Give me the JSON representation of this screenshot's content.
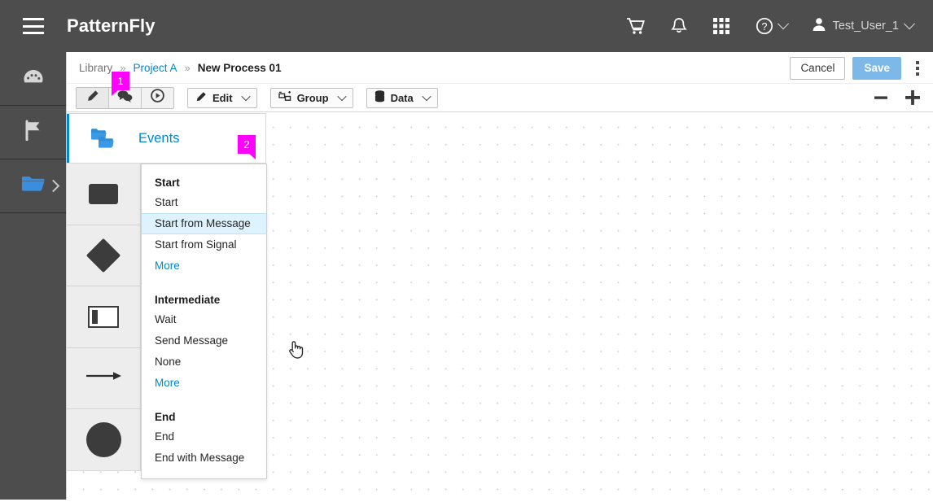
{
  "masthead": {
    "brand": "PatternFly",
    "menu_toggle_name": "global-nav-toggle",
    "icons": [
      {
        "name": "cart-icon",
        "label": "Cart"
      },
      {
        "name": "bell-icon",
        "label": "Notifications"
      },
      {
        "name": "grid-icon",
        "label": "Applications"
      },
      {
        "name": "help-icon",
        "label": "Help"
      }
    ],
    "user": "Test_User_1"
  },
  "sidebar": {
    "items": [
      {
        "name": "dashboard",
        "icon": "gauge-icon"
      },
      {
        "name": "flag",
        "icon": "flag-icon"
      },
      {
        "name": "library",
        "icon": "folder-icon",
        "active": true,
        "expandable": true
      }
    ]
  },
  "breadcrumb": {
    "items": [
      {
        "label": "Library",
        "type": "plain"
      },
      {
        "label": "Project A",
        "type": "link"
      },
      {
        "label": "New Process 01",
        "type": "current"
      }
    ],
    "separator": "»"
  },
  "actions": {
    "cancel": "Cancel",
    "save": "Save",
    "kebab_name": "more-actions-menu"
  },
  "toolbar": {
    "mode_buttons": [
      {
        "name": "edit-mode-button",
        "icon": "pencil-icon",
        "active": true
      },
      {
        "name": "comment-mode-button",
        "icon": "comments-icon",
        "active": false
      },
      {
        "name": "play-mode-button",
        "icon": "play-circle-icon",
        "active": false
      }
    ],
    "dropdowns": [
      {
        "name": "edit-dropdown",
        "label": "Edit",
        "icon": "pencil-icon"
      },
      {
        "name": "group-dropdown",
        "label": "Group",
        "icon": "group-icon"
      },
      {
        "name": "data-dropdown",
        "label": "Data",
        "icon": "database-icon"
      }
    ],
    "zoom_out": "−",
    "zoom_in": "+"
  },
  "palette": {
    "header": {
      "label": "Events",
      "icon": "events-folders-icon"
    },
    "shapes": [
      {
        "name": "palette-shape-task",
        "shape": "rectangle"
      },
      {
        "name": "palette-shape-gateway",
        "shape": "diamond"
      },
      {
        "name": "palette-shape-subprocess",
        "shape": "subprocess"
      },
      {
        "name": "palette-shape-connector",
        "shape": "arrow"
      },
      {
        "name": "palette-shape-event",
        "shape": "circle"
      }
    ]
  },
  "menu": {
    "groups": [
      {
        "title": "Start",
        "items": [
          {
            "label": "Start",
            "type": "item",
            "selected": false
          },
          {
            "label": "Start from Message",
            "type": "item",
            "selected": true
          },
          {
            "label": "Start from Signal",
            "type": "item",
            "selected": false
          },
          {
            "label": "More",
            "type": "more",
            "selected": false
          }
        ]
      },
      {
        "title": "Intermediate",
        "items": [
          {
            "label": "Wait",
            "type": "item",
            "selected": false
          },
          {
            "label": "Send Message",
            "type": "item",
            "selected": false
          },
          {
            "label": "None",
            "type": "item",
            "selected": false
          },
          {
            "label": "More",
            "type": "more",
            "selected": false
          }
        ]
      },
      {
        "title": "End",
        "items": [
          {
            "label": "End",
            "type": "item",
            "selected": false
          },
          {
            "label": "End with Message",
            "type": "item",
            "selected": false
          }
        ]
      }
    ]
  },
  "badges": [
    {
      "label": "1",
      "name": "annotation-badge-1"
    },
    {
      "label": "2",
      "name": "annotation-badge-2"
    }
  ],
  "colors": {
    "masthead_bg": "#4d4d4d",
    "accent_blue": "#0088ce",
    "save_blue": "#7cb9e8",
    "badge_magenta": "#ff00ff",
    "selected_row": "#def3ff"
  }
}
